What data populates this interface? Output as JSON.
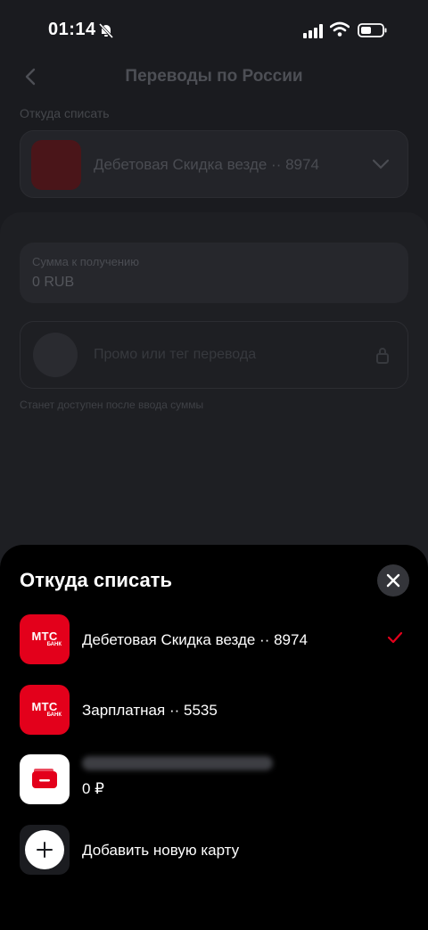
{
  "status_bar": {
    "time": "01:14"
  },
  "background": {
    "title": "Переводы по России",
    "from_label": "Откуда списать",
    "source_account": "Дебетовая Скидка везде ·· 8974",
    "amount_label": "Сумма к получению",
    "amount_value": "0 RUB",
    "promo_placeholder": "Промо или тег перевода",
    "hint": "Станет доступен после ввода суммы"
  },
  "bank_logo": {
    "name": "МТС",
    "sub": "БАНК"
  },
  "sheet": {
    "title": "Откуда списать",
    "accounts": [
      {
        "label": "Дебетовая Скидка везде ·· 8974",
        "selected": true
      },
      {
        "label": "Зарплатная ·· 5535",
        "selected": false
      },
      {
        "balance": "0 ₽"
      }
    ],
    "add_card": "Добавить новую карту"
  },
  "colors": {
    "accent": "#e3001b",
    "sheet_bg": "#000000"
  }
}
